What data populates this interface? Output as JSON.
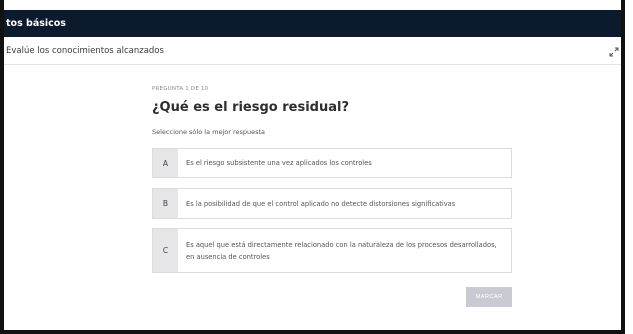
{
  "header": {
    "title": "tos básicos"
  },
  "sub_header": {
    "title": "Evalúe los conocimientos alcanzados",
    "expand_icon": "expand-arrows-icon"
  },
  "question": {
    "counter": "PREGUNTA 1 DE 10",
    "title": "¿Qué es el riesgo residual?",
    "instruction": "Seleccione sólo la mejor respuesta",
    "answers": [
      {
        "letter": "A",
        "text": "Es el riesgo subsistente una vez aplicados los controles"
      },
      {
        "letter": "B",
        "text": "Es la posibilidad de que el control aplicado no detecte distorsiones significativas"
      },
      {
        "letter": "C",
        "text": "Es aquel que está directamente relacionado con la naturaleza de los procesos desarrollados, en ausencia de controles"
      }
    ]
  },
  "actions": {
    "mark_label": "MARCAR"
  },
  "colors": {
    "header_bg": "#0b1a2d",
    "letter_bg": "#e6e6e9",
    "button_bg": "#c9cbd3"
  }
}
